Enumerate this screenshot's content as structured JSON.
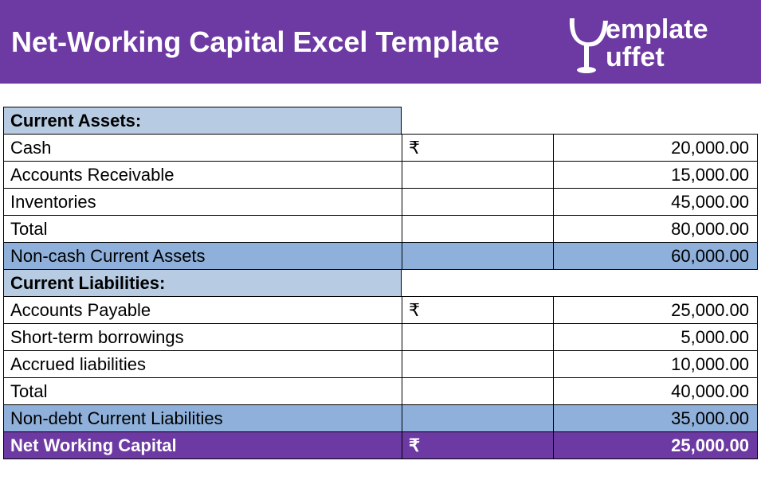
{
  "header": {
    "title": "Net-Working Capital Excel Template",
    "logo_text_top": "emplate",
    "logo_text_bottom": "uffet"
  },
  "sections": {
    "current_assets": {
      "header": "Current Assets:",
      "rows": [
        {
          "label": "Cash",
          "symbol": "₹",
          "value": "20,000.00"
        },
        {
          "label": "Accounts Receivable",
          "symbol": "",
          "value": "15,000.00"
        },
        {
          "label": "Inventories",
          "symbol": "",
          "value": "45,000.00"
        },
        {
          "label": "Total",
          "symbol": "",
          "value": "80,000.00"
        }
      ],
      "subtotal": {
        "label": "Non-cash Current Assets",
        "symbol": "",
        "value": "60,000.00"
      }
    },
    "current_liabilities": {
      "header": "Current Liabilities:",
      "rows": [
        {
          "label": "Accounts Payable",
          "symbol": "₹",
          "value": "25,000.00"
        },
        {
          "label": "Short-term borrowings",
          "symbol": "",
          "value": "5,000.00"
        },
        {
          "label": "Accrued liabilities",
          "symbol": "",
          "value": "10,000.00"
        },
        {
          "label": "Total",
          "symbol": "",
          "value": "40,000.00"
        }
      ],
      "subtotal": {
        "label": "Non-debt Current Liabilities",
        "symbol": "",
        "value": "35,000.00"
      }
    },
    "final": {
      "label": "Net Working Capital",
      "symbol": "₹",
      "value": "25,000.00"
    }
  }
}
